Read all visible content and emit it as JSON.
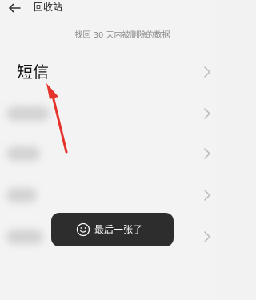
{
  "header": {
    "title": "回收站",
    "back_icon": "back-arrow-icon"
  },
  "subtitle": "找回 30 天内被删除的数据",
  "list": {
    "items": [
      {
        "label": "短信",
        "blurred": false
      },
      {
        "label": "",
        "blurred": true
      },
      {
        "label": "",
        "blurred": true
      },
      {
        "label": "",
        "blurred": true
      },
      {
        "label": "",
        "blurred": true
      }
    ],
    "chevron_icon": "chevron-right-icon"
  },
  "annotation": {
    "color": "#e5322b",
    "icon": "red-arrow-annotation"
  },
  "toast": {
    "icon": "smiley-icon",
    "text": "最后一张了",
    "background": "#2d2d2d"
  }
}
